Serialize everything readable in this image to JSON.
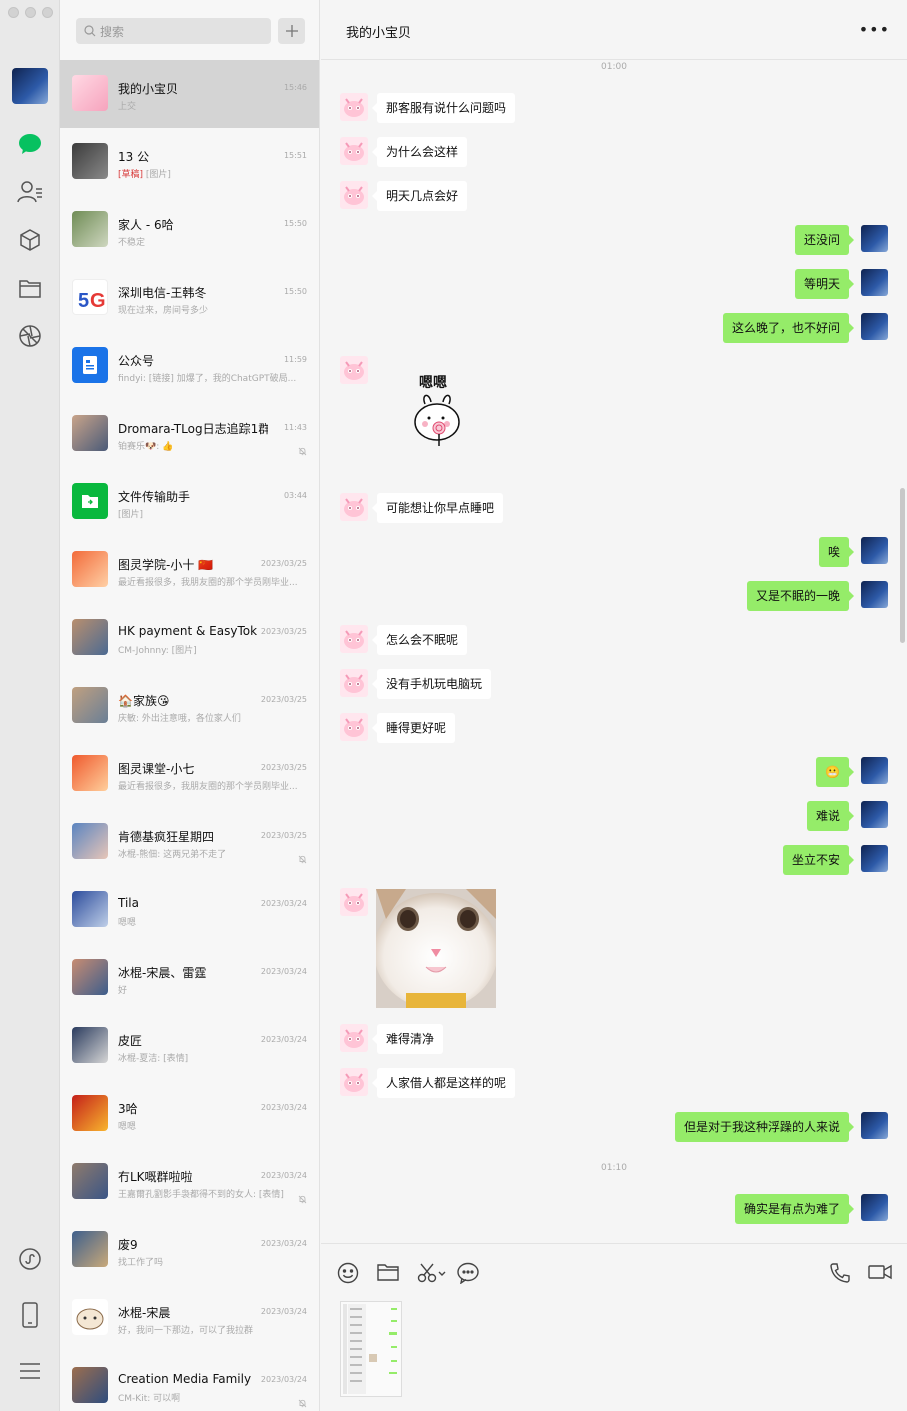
{
  "search": {
    "placeholder": "搜索"
  },
  "chat": {
    "title": "我的小宝贝",
    "more": "•••",
    "messages": [
      {
        "type": "time",
        "text": "01:00"
      },
      {
        "type": "in",
        "text": "那客服有说什么问题吗"
      },
      {
        "type": "in",
        "text": "为什么会这样"
      },
      {
        "type": "in",
        "text": "明天几点会好"
      },
      {
        "type": "out",
        "text": "还没问"
      },
      {
        "type": "out",
        "text": "等明天"
      },
      {
        "type": "out",
        "text": "这么晚了，也不好问"
      },
      {
        "type": "sticker",
        "text": "嗯嗯"
      },
      {
        "type": "in",
        "text": "可能想让你早点睡吧"
      },
      {
        "type": "out",
        "text": "唉"
      },
      {
        "type": "out",
        "text": "又是不眠的一晚"
      },
      {
        "type": "in",
        "text": "怎么会不眠呢"
      },
      {
        "type": "in",
        "text": "没有手机玩电脑玩"
      },
      {
        "type": "in",
        "text": "睡得更好呢"
      },
      {
        "type": "out",
        "text": "😬"
      },
      {
        "type": "out",
        "text": "难说"
      },
      {
        "type": "out",
        "text": "坐立不安"
      },
      {
        "type": "image",
        "text": ""
      },
      {
        "type": "in",
        "text": "难得清净"
      },
      {
        "type": "in",
        "text": "人家借人都是这样的呢"
      },
      {
        "type": "out",
        "text": "但是对于我这种浮躁的人来说"
      },
      {
        "type": "time",
        "text": "01:10"
      },
      {
        "type": "out",
        "text": "确实是有点为难了"
      }
    ]
  },
  "conversations": [
    {
      "name": "我的小宝贝",
      "time": "15:46",
      "preview": "上交",
      "active": true
    },
    {
      "name": "13 公",
      "time": "15:51",
      "draft": "[草稿]",
      "preview": " [图片]"
    },
    {
      "name": "家人 - 6哈",
      "time": "15:50",
      "preview": "不稳定"
    },
    {
      "name": "深圳电信-王韩冬",
      "time": "15:50",
      "preview": "现在过来，房间号多少"
    },
    {
      "name": "公众号",
      "time": "11:59",
      "preview": "findyi: [链接] 加爆了，我的ChatGPT破局..."
    },
    {
      "name": "Dromara-TLog日志追踪1群",
      "time": "11:43",
      "preview": "铂赛乐🐶: 👍",
      "muted": true
    },
    {
      "name": "文件传输助手",
      "time": "03:44",
      "preview": "[图片]"
    },
    {
      "name": "图灵学院-小十 🇨🇳",
      "time": "2023/03/25",
      "preview": "最近看报很多，我朋友圈的那个学员刚毕业..."
    },
    {
      "name": "HK payment & EasyTok",
      "time": "2023/03/25",
      "preview": "CM-Johnny: [图片]"
    },
    {
      "name": "🏠家族😘",
      "time": "2023/03/25",
      "preview": "庆敏: 外出注意哦，各位家人们"
    },
    {
      "name": "图灵课堂-小七",
      "time": "2023/03/25",
      "preview": "最近看报很多，我朋友圈的那个学员刚毕业..."
    },
    {
      "name": "肯德基疯狂星期四",
      "time": "2023/03/25",
      "preview": "冰棍-熊佃: 这两兄弟不走了",
      "muted": true
    },
    {
      "name": "Tila",
      "time": "2023/03/24",
      "preview": "嗯嗯"
    },
    {
      "name": "冰棍-宋晨、雷霆",
      "time": "2023/03/24",
      "preview": "好"
    },
    {
      "name": "皮匠",
      "time": "2023/03/24",
      "preview": "冰棍-夏洁: [表情]"
    },
    {
      "name": "3哈",
      "time": "2023/03/24",
      "preview": "嗯嗯"
    },
    {
      "name": "冇LK嘅群啦啦",
      "time": "2023/03/24",
      "preview": "王嘉爾孔劉影手袅都得不到的女人: [表情]",
      "muted": true
    },
    {
      "name": "废9",
      "time": "2023/03/24",
      "preview": "找工作了吗"
    },
    {
      "name": "冰棍-宋晨",
      "time": "2023/03/24",
      "preview": "好，我问一下那边，可以了我拉群"
    },
    {
      "name": "Creation Media Family",
      "time": "2023/03/24",
      "preview": "CM-Kit: 可以啊",
      "muted": true
    }
  ],
  "colors": {
    "accent_green": "#07c160",
    "outgoing_bubble": "#95ec69",
    "incoming_bubble": "#ffffff",
    "active_row": "#d4d4d4"
  }
}
